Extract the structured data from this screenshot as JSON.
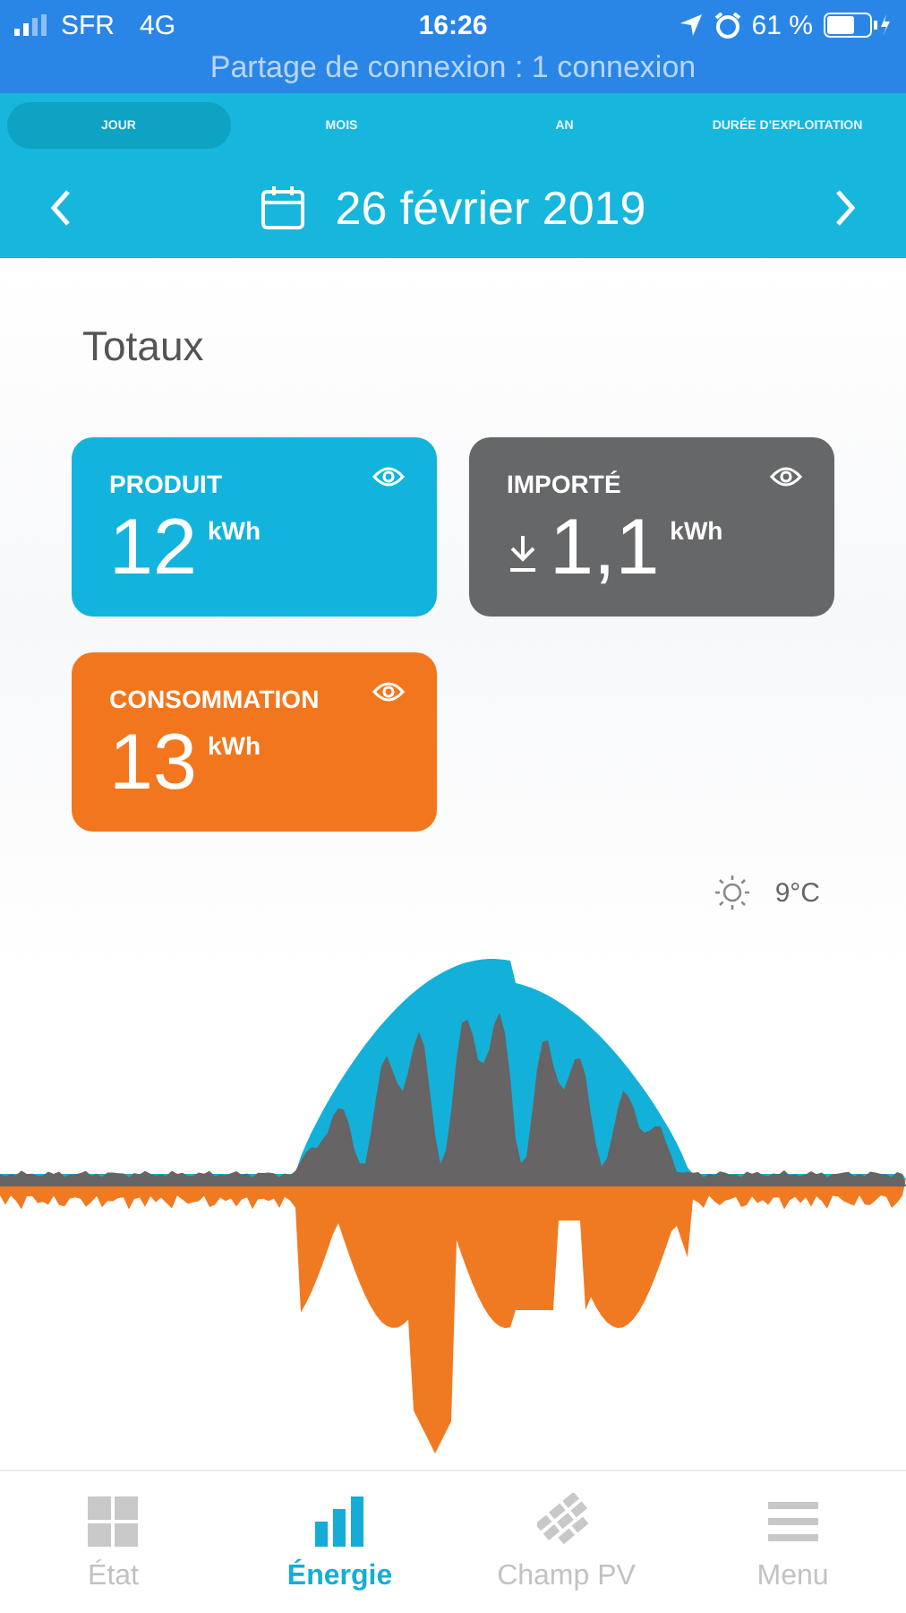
{
  "status_bar": {
    "carrier": "SFR",
    "network": "4G",
    "time": "16:26",
    "battery": "61 %",
    "hotspot": "Partage de connexion : 1 connexion"
  },
  "tabs": [
    {
      "label": "JOUR",
      "selected": true
    },
    {
      "label": "MOIS",
      "selected": false
    },
    {
      "label": "AN",
      "selected": false
    },
    {
      "label": "DURÉE D'EXPLOITATION",
      "selected": false
    }
  ],
  "date": "26 février 2019",
  "section_title": "Totaux",
  "cards": [
    {
      "label": "PRODUIT",
      "value": "12",
      "unit": "kWh",
      "color": "#12b4de",
      "kind": "plain"
    },
    {
      "label": "IMPORTÉ",
      "value": "1,1",
      "unit": "kWh",
      "color": "#666769",
      "kind": "import"
    },
    {
      "label": "CONSOMMATION",
      "value": "13",
      "unit": "kWh",
      "color": "#f2761e",
      "kind": "plain"
    }
  ],
  "weather": {
    "temperature": "9°C"
  },
  "nav": [
    {
      "label": "État",
      "kind": "grid",
      "selected": false
    },
    {
      "label": "Énergie",
      "kind": "bars",
      "selected": true
    },
    {
      "label": "Champ PV",
      "kind": "panels",
      "selected": false
    },
    {
      "label": "Menu",
      "kind": "menu",
      "selected": false
    }
  ]
}
